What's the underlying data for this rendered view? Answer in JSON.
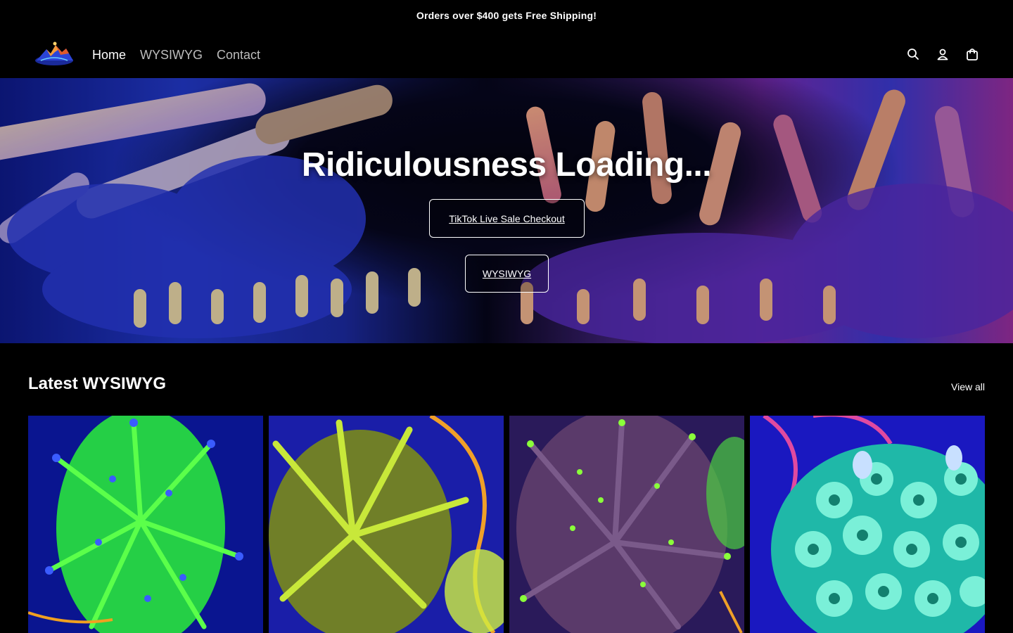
{
  "announcement": {
    "text": "Orders over $400 gets Free Shipping!"
  },
  "header": {
    "logo_icon": "coral-mountain-logo",
    "nav": [
      {
        "label": "Home",
        "active": true
      },
      {
        "label": "WYSIWYG",
        "active": false
      },
      {
        "label": "Contact",
        "active": false
      }
    ],
    "icons": [
      "search-icon",
      "account-icon",
      "cart-icon"
    ]
  },
  "hero": {
    "title": "Ridiculousness Loading...",
    "primary_button": "TikTok Live Sale Checkout",
    "secondary_button": "WYSIWYG"
  },
  "featured": {
    "title": "Latest WYSIWYG",
    "view_all": "View all",
    "products": [
      {
        "image": "green-torch-coral-blue-tips"
      },
      {
        "image": "yellow-green-torch-coral"
      },
      {
        "image": "purple-torch-coral-green-tips"
      },
      {
        "image": "teal-zoanthid-colony"
      }
    ]
  },
  "colors": {
    "background": "#000000",
    "text": "#ffffff",
    "nav_inactive": "#bdbdbd"
  }
}
